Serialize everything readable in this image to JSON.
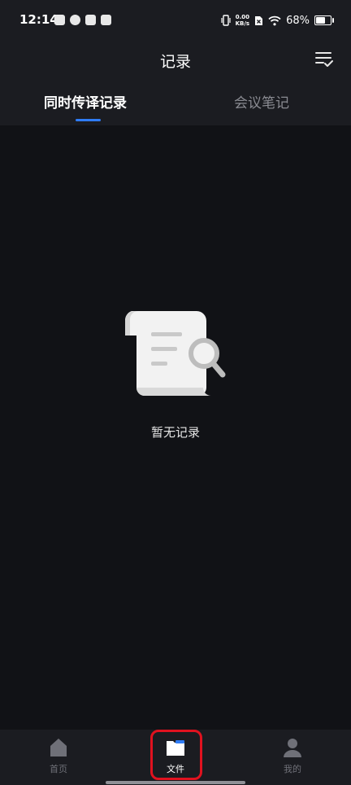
{
  "status_bar": {
    "time": "12:14",
    "net_speed_value": "0.00",
    "net_speed_unit": "KB/s",
    "battery_percent": "68%",
    "battery_level": 0.68
  },
  "header": {
    "title": "记录"
  },
  "tabs": [
    {
      "label": "同时传译记录",
      "active": true
    },
    {
      "label": "会议笔记",
      "active": false
    }
  ],
  "empty_state": {
    "message": "暂无记录"
  },
  "bottom_nav": {
    "items": [
      {
        "label": "首页",
        "icon": "home-icon",
        "active": false
      },
      {
        "label": "文件",
        "icon": "folder-icon",
        "active": true
      },
      {
        "label": "我的",
        "icon": "person-icon",
        "active": false
      }
    ]
  },
  "colors": {
    "background": "#111216",
    "surface": "#1b1c21",
    "accent": "#2f7cf6",
    "highlight": "#e0121f"
  }
}
